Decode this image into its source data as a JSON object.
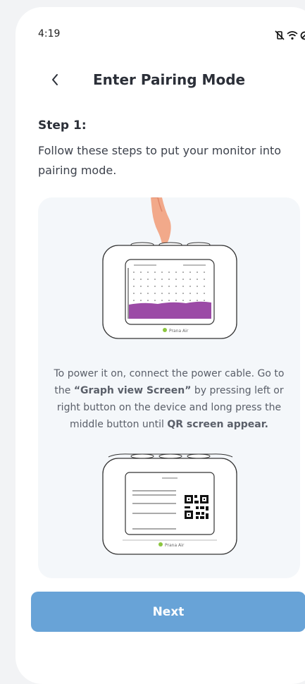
{
  "status": {
    "time": "4:19",
    "icons": [
      "vibrate-off-icon",
      "wifi-icon",
      "dnd-icon",
      "battery-icon"
    ]
  },
  "header": {
    "title": "Enter Pairing Mode",
    "back_icon": "chevron-left-icon"
  },
  "step": {
    "title": "Step 1:",
    "description": "Follow these steps to put your monitor into pairing mode."
  },
  "card": {
    "instruction_part1": "To power it on, connect the power cable. Go to the ",
    "instruction_bold1": "“Graph view Screen”",
    "instruction_part2": " by pressing left or right button on the device and long press the middle button until ",
    "instruction_bold2": "QR screen appear.",
    "brand_label": "Prana Air"
  },
  "footer": {
    "next_label": "Next"
  },
  "colors": {
    "accent": "#68a3d7",
    "card_bg": "#f4f7fa",
    "graph_fill": "#9b4aa6"
  }
}
